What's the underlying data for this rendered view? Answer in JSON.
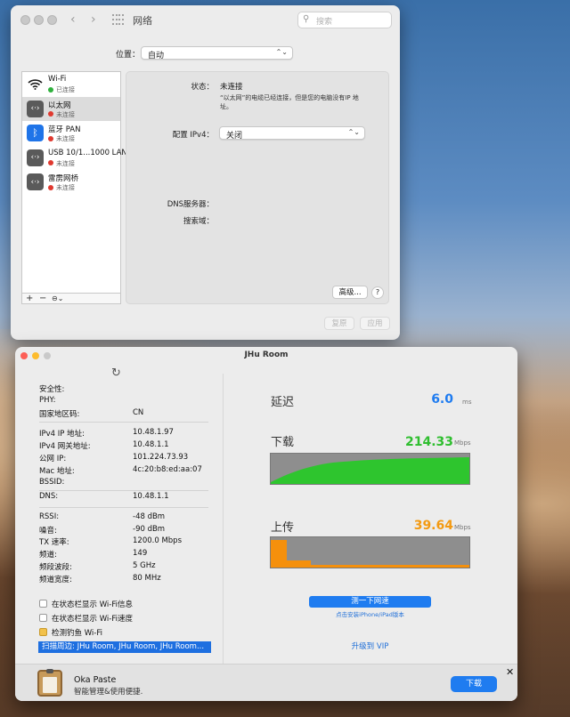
{
  "network": {
    "title": "网络",
    "search_placeholder": "搜索",
    "location_label": "位置：",
    "location_value": "自动",
    "services": [
      {
        "name": "Wi-Fi",
        "status": "已连接",
        "status_color": "green",
        "icon": "wifi-icon"
      },
      {
        "name": "以太网",
        "status": "未连接",
        "status_color": "red",
        "icon": "ethernet-icon"
      },
      {
        "name": "蓝牙 PAN",
        "status": "未连接",
        "status_color": "red",
        "icon": "bluetooth-icon"
      },
      {
        "name": "USB 10/1...1000 LAN",
        "status": "未连接",
        "status_color": "red",
        "icon": "ethernet-icon"
      },
      {
        "name": "雷雳网桥",
        "status": "未连接",
        "status_color": "red",
        "icon": "ethernet-icon"
      }
    ],
    "add_label": "+",
    "remove_label": "−",
    "action_label": "⊖⌄",
    "status_label": "状态：",
    "status_value": "未连接",
    "status_desc": "“以太网”的电缆已经连接，但是您的电脑没有IP 地址。",
    "ipv4_label": "配置 IPv4：",
    "ipv4_value": "关闭",
    "dns_label": "DNS服务器：",
    "search_domain_label": "搜索域：",
    "advanced_label": "高级...",
    "help_label": "?",
    "revert_label": "复原",
    "apply_label": "应用"
  },
  "jhu": {
    "title": "JHu Room",
    "info_group1": [
      {
        "label": "安全性:",
        "value": ""
      },
      {
        "label": "PHY:",
        "value": ""
      },
      {
        "label": "国家地区码:",
        "value": "CN"
      }
    ],
    "info_group2": [
      {
        "label": "IPv4 IP 地址:",
        "value": "10.48.1.97"
      },
      {
        "label": "IPv4 网关地址:",
        "value": "10.48.1.1"
      },
      {
        "label": "公网 IP:",
        "value": "101.224.73.93"
      },
      {
        "label": "Mac 地址:",
        "value": "4c:20:b8:ed:aa:07"
      },
      {
        "label": "BSSID:",
        "value": ""
      }
    ],
    "info_group3": [
      {
        "label": "DNS:",
        "value": "10.48.1.1"
      }
    ],
    "info_group4": [
      {
        "label": "RSSI:",
        "value": "-48 dBm"
      },
      {
        "label": "噪音:",
        "value": "-90 dBm"
      },
      {
        "label": "TX 速率:",
        "value": "1200.0 Mbps"
      },
      {
        "label": "频道:",
        "value": "149"
      },
      {
        "label": "频段波段:",
        "value": "5 GHz"
      },
      {
        "label": "频道宽度:",
        "value": "80 MHz"
      }
    ],
    "options": [
      "在状态栏显示 Wi-Fi信息",
      "在状态栏显示 Wi-Fi速度",
      "检测钓鱼 Wi-Fi"
    ],
    "scan_text": "扫描周边: JHu Room, JHu Room, JHu Room...",
    "latency_label": "延迟",
    "latency_value": "6.0",
    "latency_unit": "ms",
    "download_label": "下载",
    "download_value": "214.33",
    "download_unit": "Mbps",
    "upload_label": "上传",
    "upload_value": "39.64",
    "upload_unit": "Mbps",
    "test_button": "测一下网速",
    "install_link": "点击安装iPhone/iPad版本",
    "vip_link": "升级到 VIP",
    "colors": {
      "download": "#2fbe2f",
      "upload": "#f39a12",
      "latency": "#1f7cf0"
    }
  },
  "ad": {
    "name": "Oka Paste",
    "desc": "智能管理&使用便捷.",
    "button": "下载",
    "close": "✕"
  }
}
